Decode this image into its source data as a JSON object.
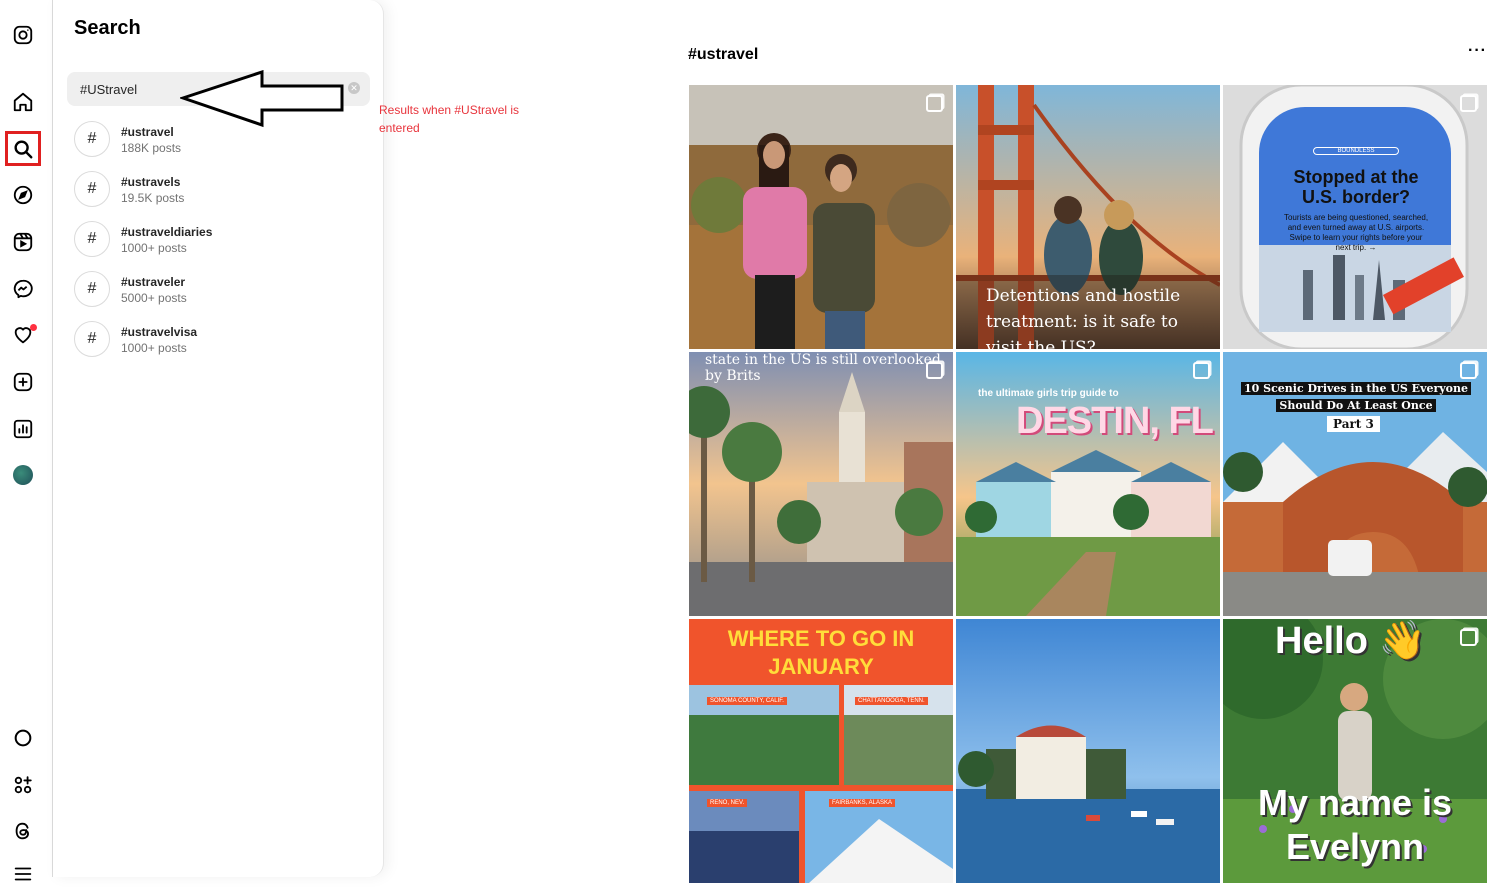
{
  "sidebar": {
    "items": [
      {
        "icon": "instagram-logo-icon"
      },
      {
        "icon": "home-icon"
      },
      {
        "icon": "search-icon",
        "active": true
      },
      {
        "icon": "explore-icon"
      },
      {
        "icon": "reels-icon"
      },
      {
        "icon": "messenger-icon"
      },
      {
        "icon": "notifications-heart-icon"
      },
      {
        "icon": "create-icon"
      },
      {
        "icon": "dashboard-icon"
      },
      {
        "icon": "profile-avatar"
      },
      {
        "icon": "threads-circle-icon"
      },
      {
        "icon": "more-apps-icon"
      },
      {
        "icon": "threads-icon"
      },
      {
        "icon": "menu-icon"
      }
    ],
    "highlight_color": "#e02020",
    "notification_dot_color": "#ff3040"
  },
  "search_panel": {
    "title": "Search",
    "query": "#UStravel",
    "results": [
      {
        "symbol": "#",
        "name": "#ustravel",
        "count": "188K posts"
      },
      {
        "symbol": "#",
        "name": "#ustravels",
        "count": "19.5K posts"
      },
      {
        "symbol": "#",
        "name": "#ustraveldiaries",
        "count": "1000+ posts"
      },
      {
        "symbol": "#",
        "name": "#ustraveler",
        "count": "5000+ posts"
      },
      {
        "symbol": "#",
        "name": "#ustravelvisa",
        "count": "1000+ posts"
      }
    ]
  },
  "annotation": {
    "text": "Results when #UStravel is entered",
    "color": "#e8343c"
  },
  "main": {
    "hashtag_title": "#ustravel",
    "more": "···",
    "tiles": [
      {
        "caption": ""
      },
      {
        "caption": "Detentions and hostile treatment: is it safe to visit the US?"
      },
      {
        "brand": "BOUNDLESS",
        "headline": "Stopped at the U.S. border?",
        "body": "Tourists are being questioned, searched, and even turned away at U.S. airports. Swipe to learn your rights before your next trip. →"
      },
      {
        "caption": "state in the US is still overlooked by Brits"
      },
      {
        "small": "the ultimate girls trip guide to",
        "headline": "DESTIN, FL"
      },
      {
        "line1": "10 Scenic Drives in the US Everyone",
        "line2": "Should Do At Least Once",
        "part": "Part 3"
      },
      {
        "headline": "WHERE TO GO IN JANUARY",
        "labels": [
          "SONOMA COUNTY, CALIF.",
          "CHATTANOOGA, TENN.",
          "RENO, NEV.",
          "FAIRBANKS, ALASKA"
        ]
      },
      {
        "caption": ""
      },
      {
        "top": "Hello",
        "emoji": "👋",
        "bottom1": "My name is",
        "bottom2": "Evelynn"
      }
    ]
  }
}
